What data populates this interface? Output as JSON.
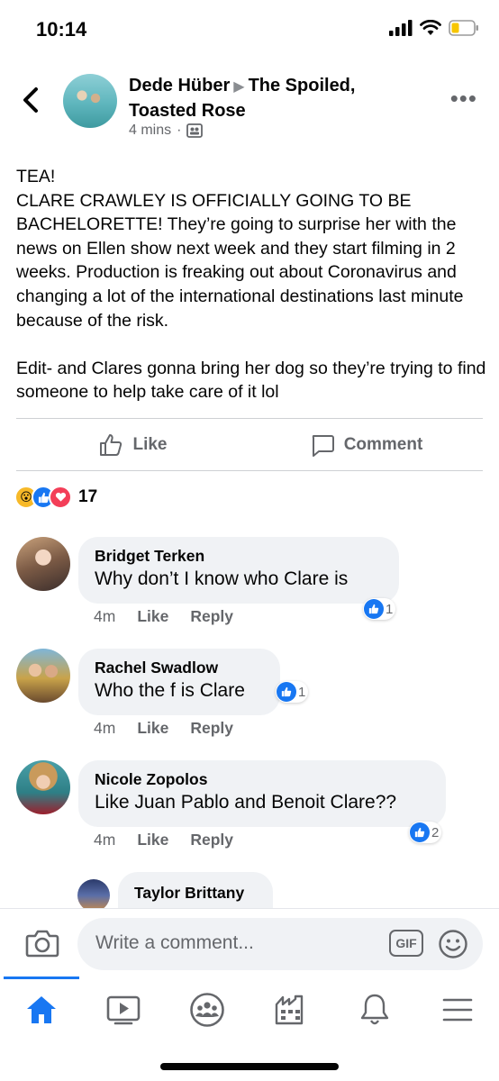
{
  "status": {
    "time": "10:14"
  },
  "post": {
    "author": "Dede Hüber",
    "group": "The Spoiled, Toasted Rose",
    "time": "4 mins",
    "text": "TEA!\nCLARE CRAWLEY IS OFFICIALLY GOING TO BE BACHELORETTE! They’re going to surprise her with the news on Ellen show next week and they start filming in 2 weeks. Production is freaking out about Coronavirus and changing a lot of the international destinations last minute because of the risk.\n\nEdit- and Clares gonna bring her dog so they’re trying to find someone to help take care of it lol",
    "like_label": "Like",
    "comment_label": "Comment",
    "reaction_count": "17"
  },
  "comments": [
    {
      "name": "Bridget Terken",
      "text": "Why don’t I know who Clare is",
      "time": "4m",
      "like": "Like",
      "reply": "Reply",
      "likes": "1"
    },
    {
      "name": "Rachel Swadlow",
      "text": "Who the f is Clare",
      "time": "4m",
      "like": "Like",
      "reply": "Reply",
      "likes": "1"
    },
    {
      "name": "Nicole Zopolos",
      "text": "Like Juan Pablo and Benoit Clare??",
      "time": "4m",
      "like": "Like",
      "reply": "Reply",
      "likes": "2"
    },
    {
      "name": "Taylor Brittany"
    }
  ],
  "composer": {
    "placeholder": "Write a comment...",
    "gif": "GIF"
  },
  "icons": {
    "back": "chevron-left-icon",
    "more": "more-icon",
    "privacy": "group-icon",
    "like": "thumbs-up-icon",
    "comment": "comment-icon",
    "camera": "camera-icon",
    "emoji": "emoji-icon",
    "tabs": [
      "home-icon",
      "watch-icon",
      "groups-icon",
      "marketplace-icon",
      "notifications-icon",
      "menu-icon"
    ]
  },
  "colors": {
    "accent": "#1877f2",
    "secondary_text": "#65676b",
    "bubble": "#f0f2f5",
    "love": "#f33e58",
    "wow": "#f7b928"
  }
}
